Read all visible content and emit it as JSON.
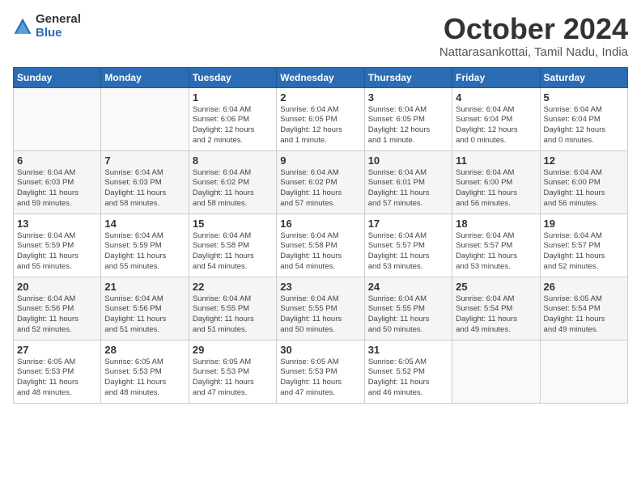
{
  "header": {
    "logo_general": "General",
    "logo_blue": "Blue",
    "month_title": "October 2024",
    "location": "Nattarasankottai, Tamil Nadu, India"
  },
  "calendar": {
    "days_of_week": [
      "Sunday",
      "Monday",
      "Tuesday",
      "Wednesday",
      "Thursday",
      "Friday",
      "Saturday"
    ],
    "weeks": [
      [
        {
          "day": "",
          "info": ""
        },
        {
          "day": "",
          "info": ""
        },
        {
          "day": "1",
          "info": "Sunrise: 6:04 AM\nSunset: 6:06 PM\nDaylight: 12 hours\nand 2 minutes."
        },
        {
          "day": "2",
          "info": "Sunrise: 6:04 AM\nSunset: 6:05 PM\nDaylight: 12 hours\nand 1 minute."
        },
        {
          "day": "3",
          "info": "Sunrise: 6:04 AM\nSunset: 6:05 PM\nDaylight: 12 hours\nand 1 minute."
        },
        {
          "day": "4",
          "info": "Sunrise: 6:04 AM\nSunset: 6:04 PM\nDaylight: 12 hours\nand 0 minutes."
        },
        {
          "day": "5",
          "info": "Sunrise: 6:04 AM\nSunset: 6:04 PM\nDaylight: 12 hours\nand 0 minutes."
        }
      ],
      [
        {
          "day": "6",
          "info": "Sunrise: 6:04 AM\nSunset: 6:03 PM\nDaylight: 11 hours\nand 59 minutes."
        },
        {
          "day": "7",
          "info": "Sunrise: 6:04 AM\nSunset: 6:03 PM\nDaylight: 11 hours\nand 58 minutes."
        },
        {
          "day": "8",
          "info": "Sunrise: 6:04 AM\nSunset: 6:02 PM\nDaylight: 11 hours\nand 58 minutes."
        },
        {
          "day": "9",
          "info": "Sunrise: 6:04 AM\nSunset: 6:02 PM\nDaylight: 11 hours\nand 57 minutes."
        },
        {
          "day": "10",
          "info": "Sunrise: 6:04 AM\nSunset: 6:01 PM\nDaylight: 11 hours\nand 57 minutes."
        },
        {
          "day": "11",
          "info": "Sunrise: 6:04 AM\nSunset: 6:00 PM\nDaylight: 11 hours\nand 56 minutes."
        },
        {
          "day": "12",
          "info": "Sunrise: 6:04 AM\nSunset: 6:00 PM\nDaylight: 11 hours\nand 56 minutes."
        }
      ],
      [
        {
          "day": "13",
          "info": "Sunrise: 6:04 AM\nSunset: 5:59 PM\nDaylight: 11 hours\nand 55 minutes."
        },
        {
          "day": "14",
          "info": "Sunrise: 6:04 AM\nSunset: 5:59 PM\nDaylight: 11 hours\nand 55 minutes."
        },
        {
          "day": "15",
          "info": "Sunrise: 6:04 AM\nSunset: 5:58 PM\nDaylight: 11 hours\nand 54 minutes."
        },
        {
          "day": "16",
          "info": "Sunrise: 6:04 AM\nSunset: 5:58 PM\nDaylight: 11 hours\nand 54 minutes."
        },
        {
          "day": "17",
          "info": "Sunrise: 6:04 AM\nSunset: 5:57 PM\nDaylight: 11 hours\nand 53 minutes."
        },
        {
          "day": "18",
          "info": "Sunrise: 6:04 AM\nSunset: 5:57 PM\nDaylight: 11 hours\nand 53 minutes."
        },
        {
          "day": "19",
          "info": "Sunrise: 6:04 AM\nSunset: 5:57 PM\nDaylight: 11 hours\nand 52 minutes."
        }
      ],
      [
        {
          "day": "20",
          "info": "Sunrise: 6:04 AM\nSunset: 5:56 PM\nDaylight: 11 hours\nand 52 minutes."
        },
        {
          "day": "21",
          "info": "Sunrise: 6:04 AM\nSunset: 5:56 PM\nDaylight: 11 hours\nand 51 minutes."
        },
        {
          "day": "22",
          "info": "Sunrise: 6:04 AM\nSunset: 5:55 PM\nDaylight: 11 hours\nand 51 minutes."
        },
        {
          "day": "23",
          "info": "Sunrise: 6:04 AM\nSunset: 5:55 PM\nDaylight: 11 hours\nand 50 minutes."
        },
        {
          "day": "24",
          "info": "Sunrise: 6:04 AM\nSunset: 5:55 PM\nDaylight: 11 hours\nand 50 minutes."
        },
        {
          "day": "25",
          "info": "Sunrise: 6:04 AM\nSunset: 5:54 PM\nDaylight: 11 hours\nand 49 minutes."
        },
        {
          "day": "26",
          "info": "Sunrise: 6:05 AM\nSunset: 5:54 PM\nDaylight: 11 hours\nand 49 minutes."
        }
      ],
      [
        {
          "day": "27",
          "info": "Sunrise: 6:05 AM\nSunset: 5:53 PM\nDaylight: 11 hours\nand 48 minutes."
        },
        {
          "day": "28",
          "info": "Sunrise: 6:05 AM\nSunset: 5:53 PM\nDaylight: 11 hours\nand 48 minutes."
        },
        {
          "day": "29",
          "info": "Sunrise: 6:05 AM\nSunset: 5:53 PM\nDaylight: 11 hours\nand 47 minutes."
        },
        {
          "day": "30",
          "info": "Sunrise: 6:05 AM\nSunset: 5:53 PM\nDaylight: 11 hours\nand 47 minutes."
        },
        {
          "day": "31",
          "info": "Sunrise: 6:05 AM\nSunset: 5:52 PM\nDaylight: 11 hours\nand 46 minutes."
        },
        {
          "day": "",
          "info": ""
        },
        {
          "day": "",
          "info": ""
        }
      ]
    ]
  }
}
